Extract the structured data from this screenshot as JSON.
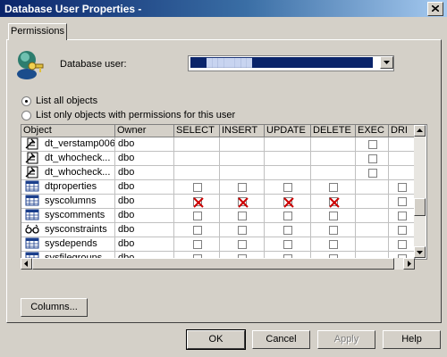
{
  "window": {
    "title": "Database User Properties -",
    "close_label": "×"
  },
  "tabs": [
    {
      "label": "Permissions"
    }
  ],
  "user_section": {
    "label": "Database user:",
    "selected_value": "████████",
    "icon": "user-key-icon"
  },
  "filter": {
    "options": [
      {
        "label": "List all objects",
        "selected": true
      },
      {
        "label": "List only objects with permissions for this user",
        "selected": false
      }
    ]
  },
  "grid": {
    "columns": [
      "Object",
      "Owner",
      "SELECT",
      "INSERT",
      "UPDATE",
      "DELETE",
      "EXEC",
      "DRI"
    ],
    "rows": [
      {
        "icon": "stored-procedure-icon",
        "object": "dt_verstamp006",
        "owner": "dbo",
        "perms": [
          "",
          "",
          "",
          "",
          "empty",
          ""
        ]
      },
      {
        "icon": "stored-procedure-icon",
        "object": "dt_whocheck...",
        "owner": "dbo",
        "perms": [
          "",
          "",
          "",
          "",
          "empty",
          ""
        ]
      },
      {
        "icon": "stored-procedure-icon",
        "object": "dt_whocheck...",
        "owner": "dbo",
        "perms": [
          "",
          "",
          "",
          "",
          "empty",
          ""
        ]
      },
      {
        "icon": "table-icon",
        "object": "dtproperties",
        "owner": "dbo",
        "perms": [
          "empty",
          "empty",
          "empty",
          "empty",
          "",
          "empty"
        ]
      },
      {
        "icon": "table-icon",
        "object": "syscolumns",
        "owner": "dbo",
        "perms": [
          "denied",
          "denied",
          "denied",
          "denied",
          "",
          "empty"
        ]
      },
      {
        "icon": "table-icon",
        "object": "syscomments",
        "owner": "dbo",
        "perms": [
          "empty",
          "empty",
          "empty",
          "empty",
          "",
          "empty"
        ]
      },
      {
        "icon": "view-icon",
        "object": "sysconstraints",
        "owner": "dbo",
        "perms": [
          "empty",
          "empty",
          "empty",
          "empty",
          "",
          "empty"
        ]
      },
      {
        "icon": "table-icon",
        "object": "sysdepends",
        "owner": "dbo",
        "perms": [
          "empty",
          "empty",
          "empty",
          "empty",
          "",
          "empty"
        ]
      },
      {
        "icon": "table-icon",
        "object": "sysfilegroups",
        "owner": "dbo",
        "perms": [
          "empty",
          "empty",
          "empty",
          "empty",
          "",
          "empty"
        ]
      }
    ]
  },
  "buttons": {
    "columns": "Columns...",
    "ok": "OK",
    "cancel": "Cancel",
    "apply": "Apply",
    "help": "Help"
  },
  "colors": {
    "title_bar": "#0a246a",
    "dialog_bg": "#d4d0c8",
    "deny_mark": "#cc0000"
  }
}
